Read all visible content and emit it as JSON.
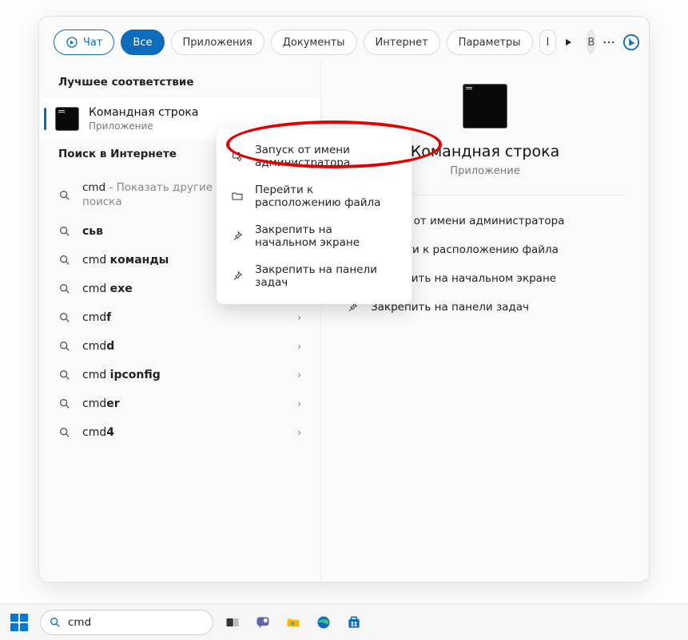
{
  "tabs": {
    "chat": "Чат",
    "all": "Все",
    "apps": "Приложения",
    "docs": "Документы",
    "web": "Интернет",
    "params": "Параметры",
    "trunc": "I",
    "avatar_letter": "В"
  },
  "left": {
    "best_match_heading": "Лучшее соответствие",
    "result_title": "Командная строка",
    "result_sub": "Приложение",
    "web_heading": "Поиск в Интернете",
    "items": [
      {
        "prefix": "cmd",
        "suffix": " - Показать другие результаты поиска",
        "chev": false
      },
      {
        "prefix": "",
        "bold": "cьв",
        "chev": false
      },
      {
        "prefix": "cmd ",
        "bold": "команды",
        "chev": true
      },
      {
        "prefix": "cmd ",
        "bold": "exe",
        "chev": true
      },
      {
        "prefix": "cmd",
        "bold": "f",
        "chev": true
      },
      {
        "prefix": "cmd",
        "bold": "d",
        "chev": true
      },
      {
        "prefix": "cmd ",
        "bold": "ipconfig",
        "chev": true
      },
      {
        "prefix": "cmd",
        "bold": "er",
        "chev": true
      },
      {
        "prefix": "cmd",
        "bold": "4",
        "chev": true
      }
    ]
  },
  "context_menu": {
    "items": [
      "Запуск от имени администратора",
      "Перейти к расположению файла",
      "Закрепить на начальном экране",
      "Закрепить на панели задач"
    ]
  },
  "right": {
    "title": "Командная строка",
    "sub": "Приложение",
    "actions": [
      "Запуск от имени администратора",
      "Перейти к расположению файла",
      "Закрепить на начальном экране",
      "Закрепить на панели задач"
    ]
  },
  "taskbar": {
    "search_value": "cmd"
  }
}
